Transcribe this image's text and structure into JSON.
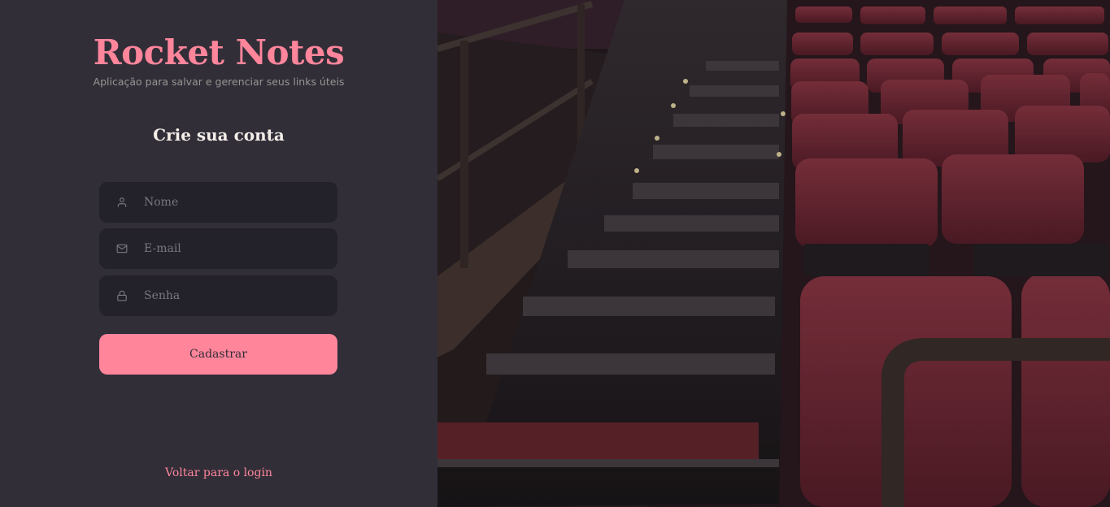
{
  "brand": {
    "title": "Rocket Notes",
    "tagline": "Aplicação para salvar e gerenciar seus links úteis"
  },
  "form": {
    "title": "Crie sua conta",
    "fields": [
      {
        "icon": "user-icon",
        "placeholder": "Nome",
        "value": ""
      },
      {
        "icon": "mail-icon",
        "placeholder": "E-mail",
        "value": ""
      },
      {
        "icon": "lock-icon",
        "placeholder": "Senha",
        "value": ""
      }
    ],
    "submit_label": "Cadastrar"
  },
  "back_link": "Voltar para o login",
  "colors": {
    "background": "#312E38",
    "input_background": "#232129",
    "accent": "#FF859B",
    "text": "#F4EDE8",
    "muted": "#999591"
  },
  "hero": {
    "image": "theater-stairs-photo"
  }
}
